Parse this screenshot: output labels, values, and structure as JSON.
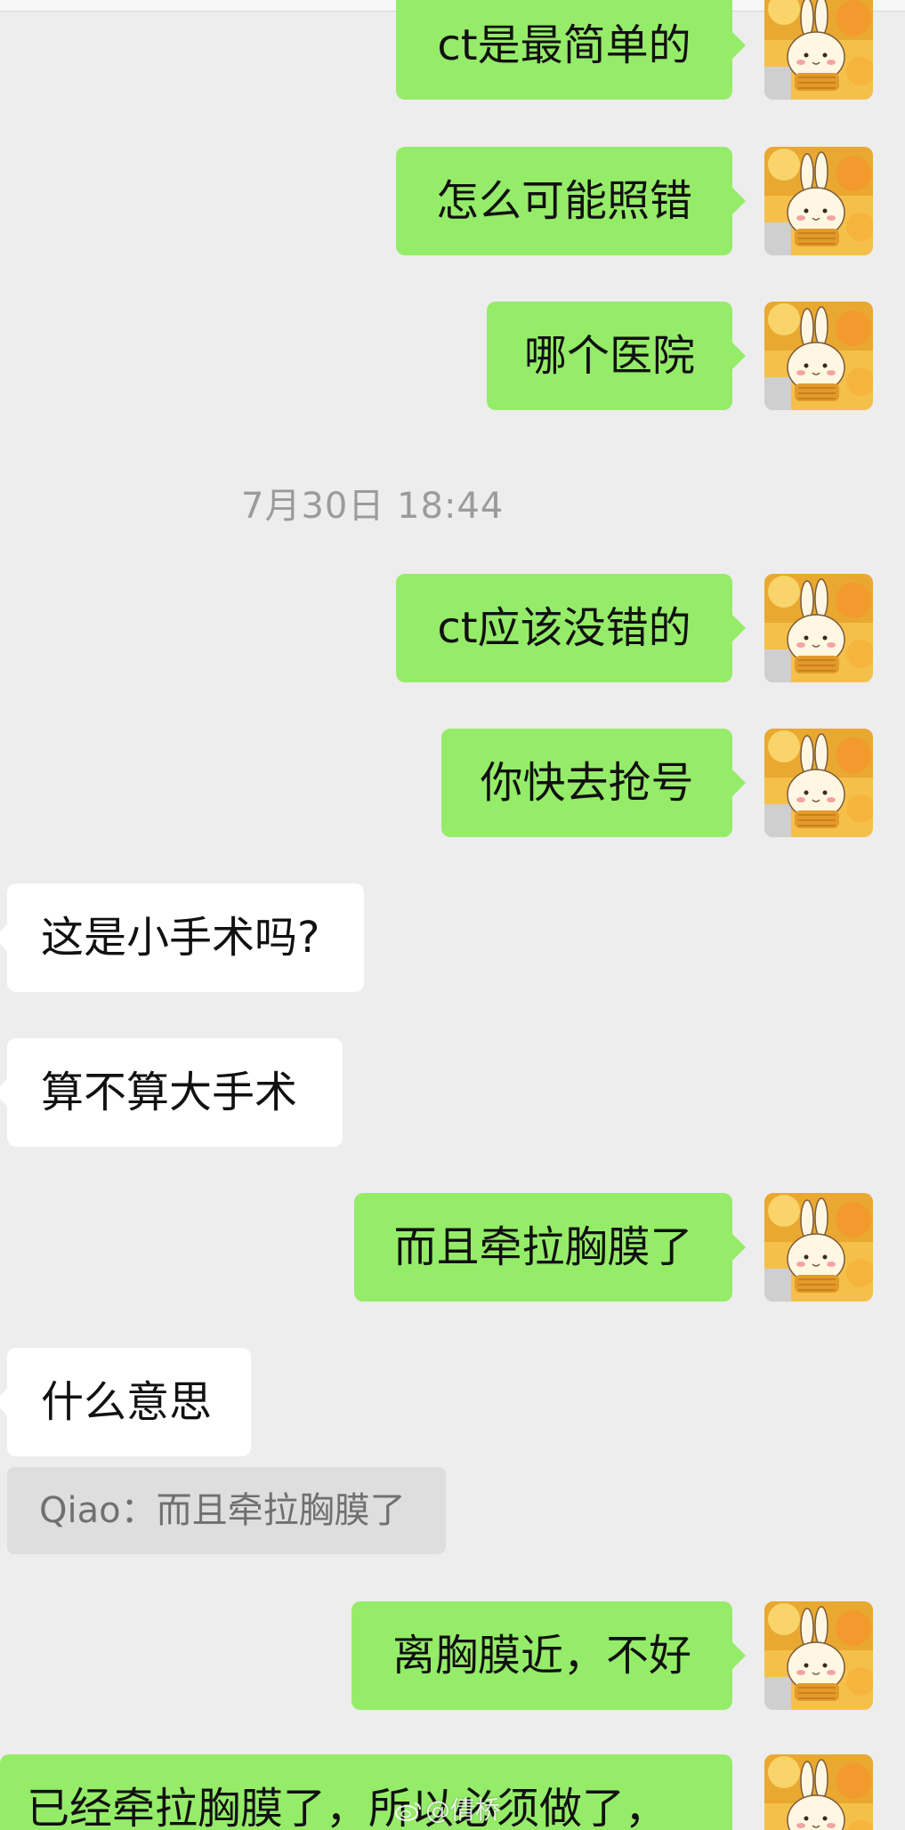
{
  "messages": [
    {
      "id": "m1",
      "dir": "out",
      "text": "ct是最简单的"
    },
    {
      "id": "m2",
      "dir": "out",
      "text": "怎么可能照错"
    },
    {
      "id": "m3",
      "dir": "out",
      "text": "哪个医院"
    },
    {
      "id": "m4",
      "dir": "out",
      "text": "ct应该没错的"
    },
    {
      "id": "m5",
      "dir": "out",
      "text": "你快去抢号"
    },
    {
      "id": "m6",
      "dir": "in",
      "text": "这是小手术吗?"
    },
    {
      "id": "m7",
      "dir": "in",
      "text": "算不算大手术"
    },
    {
      "id": "m8",
      "dir": "out",
      "text": "而且牵拉胸膜了"
    },
    {
      "id": "m9",
      "dir": "in",
      "text": "什么意思"
    },
    {
      "id": "m10",
      "dir": "out",
      "text": "离胸膜近，不好"
    },
    {
      "id": "m11",
      "dir": "out",
      "text": "已经牵拉胸膜了，所以必须做了，"
    }
  ],
  "timestamp": "7月30日 18:44",
  "quote": "Qiao：而且牵拉胸膜了",
  "watermark": "@倩桥",
  "avatar_icon": "bunny-avatar-icon",
  "colors": {
    "background": "#ededed",
    "outgoing_bubble": "#95ec69",
    "incoming_bubble": "#ffffff",
    "timestamp_text": "#9b9b9b",
    "quote_bg": "#dedede"
  }
}
